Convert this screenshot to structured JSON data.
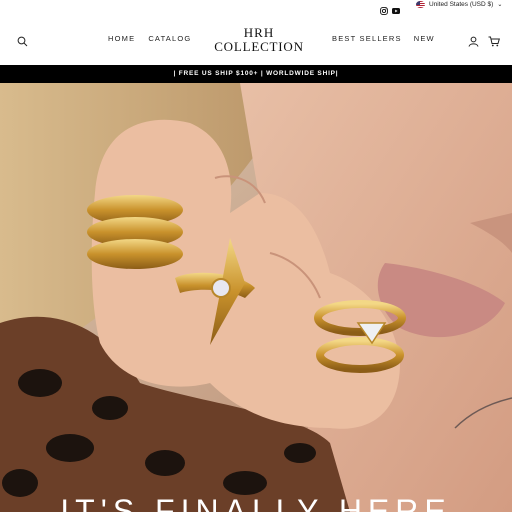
{
  "topbar": {
    "social": [
      "instagram-icon",
      "youtube-icon"
    ],
    "currency_label": "United States (USD $)"
  },
  "header": {
    "nav_left": [
      "HOME",
      "CATALOG"
    ],
    "logo_line1": "HRH",
    "logo_line2": "COLLECTION",
    "nav_right": [
      "BEST SELLERS",
      "NEW"
    ]
  },
  "announcement": "| FREE US SHIP $100+ | WORLDWIDE SHIP|",
  "hero": {
    "headline": "IT'S FINALLY HERE"
  },
  "colors": {
    "announcement_bg": "#000000",
    "gold": "#d4a63a",
    "skin": "#e2b29a"
  }
}
